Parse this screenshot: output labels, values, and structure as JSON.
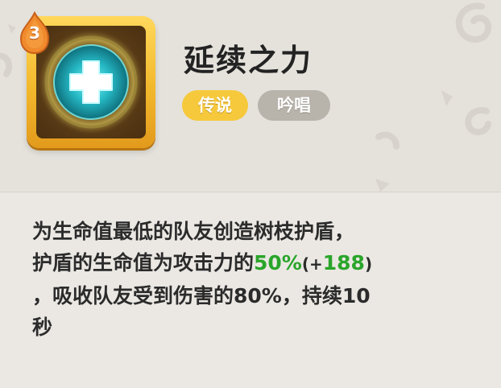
{
  "skill": {
    "level": "3",
    "name": "延续之力",
    "tags": {
      "rarity": "传说",
      "type": "吟唱"
    },
    "icon": "heal-cross-icon",
    "description": {
      "line1": "为生命值最低的队友创造树枝护盾，",
      "line2_prefix": "护盾的生命值为攻击力的",
      "line2_percent": "50%",
      "line2_paren_open": "(+",
      "line2_bonus": "188",
      "line2_paren_close": ")",
      "line3": "，吸收队友受到伤害的80%，持续10",
      "line4": "秒"
    }
  },
  "colors": {
    "frame_gold": "#f2b82c",
    "tag_legend": "#f6c93c",
    "tag_chant": "#b8b3ab",
    "highlight_green": "#2aa52a",
    "glow_cyan": "#3fe0e8"
  }
}
